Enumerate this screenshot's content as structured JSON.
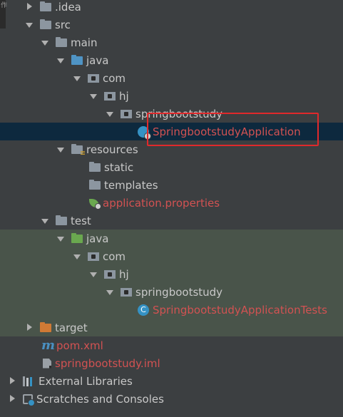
{
  "edge_glyph": "作",
  "tree": {
    "idea": ".idea",
    "src": "src",
    "main": "main",
    "java_main": "java",
    "com_main": "com",
    "hj_main": "hj",
    "pkg_main": "springbootstudy",
    "app_class": "SpringbootstudyApplication",
    "resources": "resources",
    "static": "static",
    "templates": "templates",
    "app_properties": "application.properties",
    "test": "test",
    "java_test": "java",
    "com_test": "com",
    "hj_test": "hj",
    "pkg_test": "springbootstudy",
    "test_class": "SpringbootstudyApplicationTests",
    "target": "target",
    "pom": "pom.xml",
    "iml": "springbootstudy.iml",
    "external_libraries": "External Libraries",
    "scratches": "Scratches and Consoles"
  },
  "icons": {
    "class_icon_letter": "C",
    "maven_icon_letter": "m"
  },
  "colors": {
    "background": "#3c3f41",
    "selection": "#0d293e",
    "test_background": "#49544a",
    "modified_text": "#d25252",
    "highlight_border": "#e0292b"
  }
}
